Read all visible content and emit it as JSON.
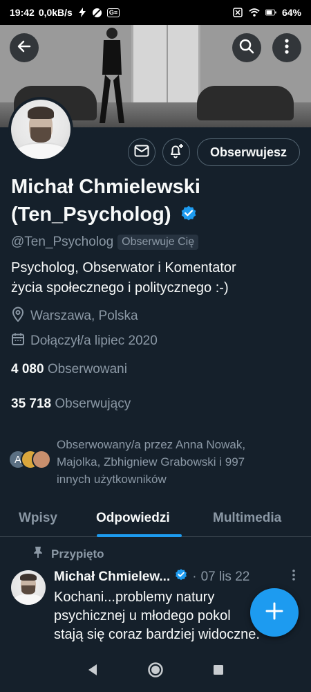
{
  "status_bar": {
    "time": "19:42",
    "network_speed": "0,0kB/s",
    "battery": "64%",
    "icons": [
      "bolt-icon",
      "no-signal-icon",
      "notification-badge-icon",
      "sim-icon",
      "wifi-icon",
      "battery-icon"
    ]
  },
  "header": {
    "back_icon": "arrow-left-icon",
    "search_icon": "search-icon",
    "more_icon": "more-vertical-icon"
  },
  "profile": {
    "name_line1": "Michał Chmielewski",
    "name_line2": "(Ten_Psycholog)",
    "verified": true,
    "handle": "@Ten_Psycholog",
    "follows_you_label": "Obserwuje Cię",
    "bio_line1": "Psycholog, Obserwator i Komentator",
    "bio_line2": "życia społecznego i politycznego :-)",
    "location": "Warszawa, Polska",
    "joined": "Dołączył/a lipiec 2020",
    "following_count": "4 080",
    "following_label": "Obserwowani",
    "followers_count": "35 718",
    "followers_label": "Obserwujący",
    "follow_button_label": "Obserwujesz"
  },
  "followed_by": {
    "line1": "Obserwowany/a przez Anna Nowak,",
    "line2": "Majolka, Zbhigniew Grabowski i 997",
    "line3": "innych użytkowników",
    "first_avatar_letter": "A"
  },
  "tabs": [
    {
      "label": "Wpisy",
      "active": false
    },
    {
      "label": "Odpowiedzi",
      "active": true
    },
    {
      "label": "Multimedia",
      "active": false
    }
  ],
  "pinned_tweet": {
    "pinned_label": "Przypięto",
    "author": "Michał Chmielew...",
    "date": "07 lis 22",
    "text_line1": "Kochani...problemy natury",
    "text_line2": "psychicznej u młodego pokol",
    "text_line3": "stają się coraz bardziej widoczne."
  },
  "colors": {
    "background": "#15202b",
    "accent": "#1d9bf0",
    "secondary_text": "#8b98a5",
    "border": "#536471"
  }
}
